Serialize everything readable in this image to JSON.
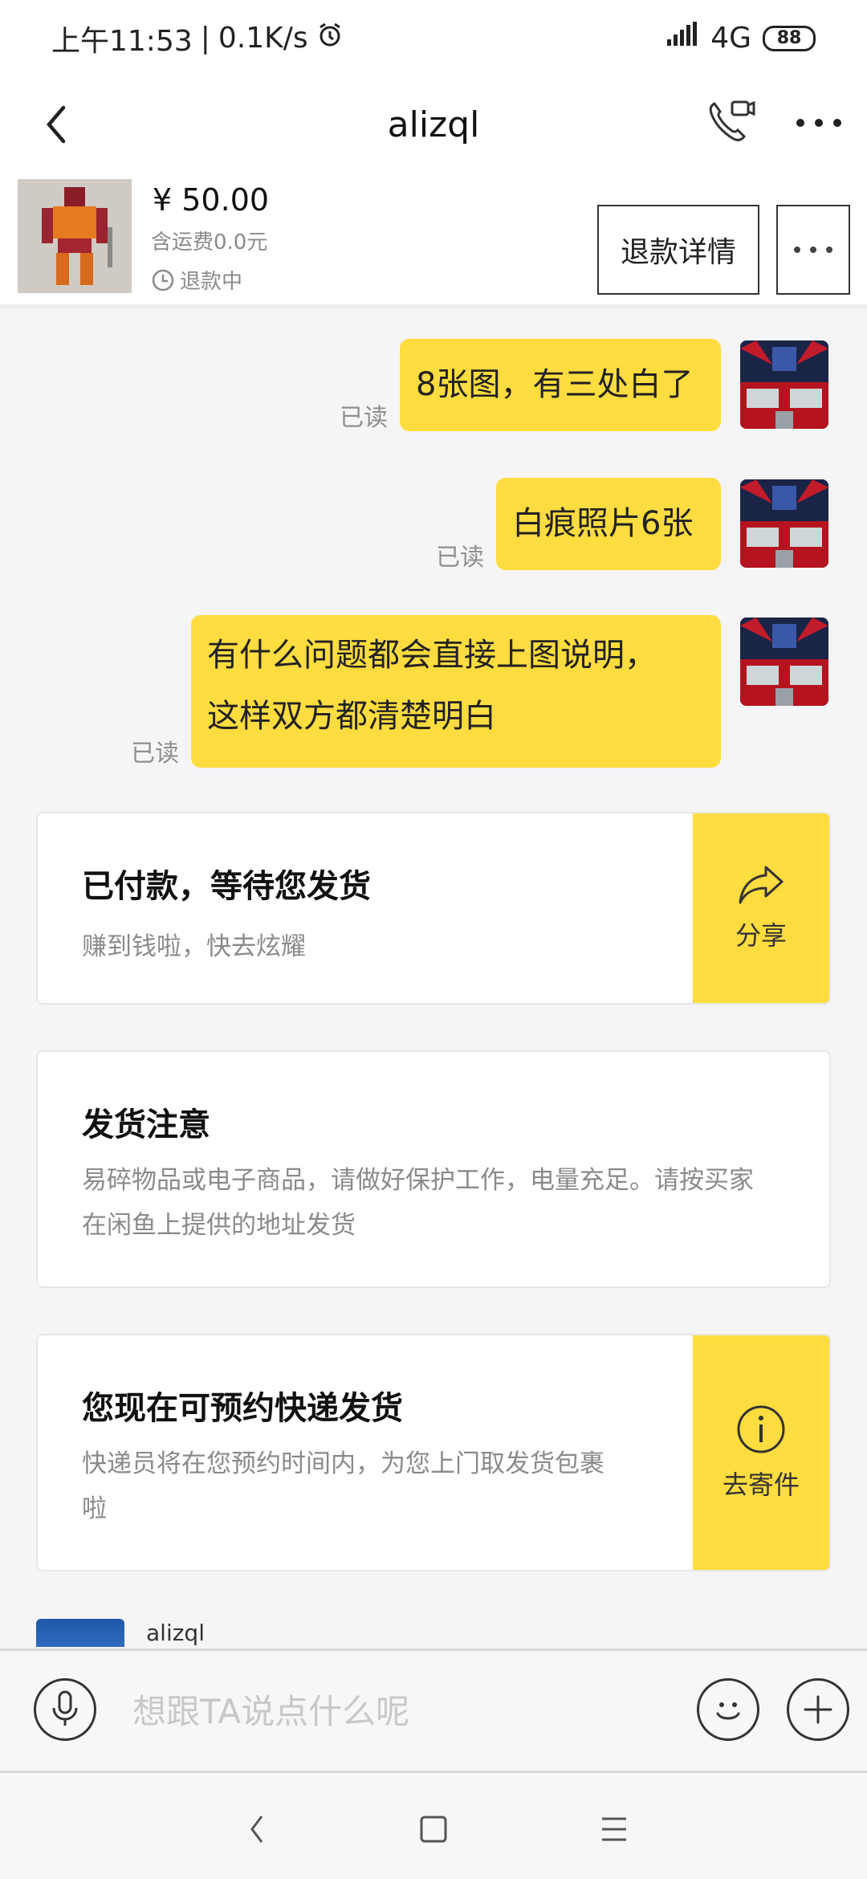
{
  "status_bar": {
    "time": "上午11:53",
    "separator": "|",
    "speed": "0.1K/s",
    "network": "4G",
    "battery": "88"
  },
  "header": {
    "title": "alizql"
  },
  "product": {
    "price": "¥ 50.00",
    "shipping": "含运费0.0元",
    "status": "退款中",
    "refund_button": "退款详情"
  },
  "messages": [
    {
      "text": "8张图，有三处白了",
      "read": "已读"
    },
    {
      "text": "白痕照片6张",
      "read": "已读"
    },
    {
      "text_line1": "有什么问题都会直接上图说明，",
      "text_line2": "这样双方都清楚明白",
      "read": "已读"
    }
  ],
  "cards": {
    "paid": {
      "title": "已付款，等待您发货",
      "subtitle": "赚到钱啦，快去炫耀",
      "action": "分享"
    },
    "notice": {
      "title": "发货注意",
      "line1": "易碎物品或电子商品，请做好保护工作，电量充足。请按买家",
      "line2": "在闲鱼上提供的地址发货"
    },
    "courier": {
      "title": "您现在可预约快递发货",
      "line1": "快递员将在您预约时间内，为您上门取发货包裹",
      "line2": "啦",
      "action": "去寄件"
    }
  },
  "peer": {
    "name": "alizql"
  },
  "input": {
    "placeholder": "想跟TA说点什么呢"
  },
  "colors": {
    "bubble": "#ffdc3f",
    "accent": "#ffdc3f",
    "background": "#f5f5f7"
  }
}
